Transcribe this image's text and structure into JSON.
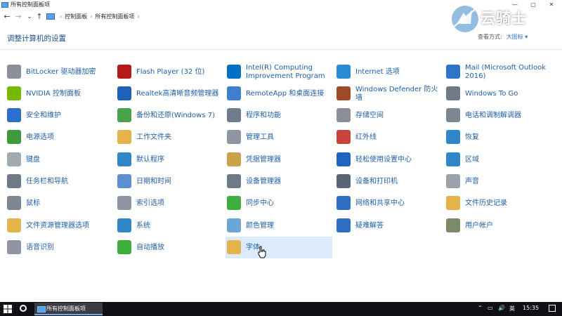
{
  "window": {
    "title": "所有控制面板项",
    "minimize": "—",
    "maximize": "▢",
    "close": "✕"
  },
  "address": {
    "back": "←",
    "forward": "→",
    "dropdown": "⌄",
    "up": "↑",
    "crumbs": [
      "控制面板",
      "所有控制面板项"
    ],
    "separator": "›"
  },
  "header": {
    "page_title": "调整计算机的设置",
    "view_by_label": "查看方式:",
    "view_by_value": "大图标 ▾"
  },
  "watermark": {
    "text": "云骑士"
  },
  "items": [
    {
      "label": "BitLocker 驱动器加密",
      "icon": "bitlocker-icon",
      "color": "#8a8f99"
    },
    {
      "label": "Flash Player (32 位)",
      "icon": "flash-icon",
      "color": "#b31b1b"
    },
    {
      "label": "Intel(R) Computing Improvement Program",
      "icon": "intel-icon",
      "color": "#0071c5"
    },
    {
      "label": "Internet 选项",
      "icon": "globe-icon",
      "color": "#2b8cd6"
    },
    {
      "label": "Mail (Microsoft Outlook 2016)",
      "icon": "mail-icon",
      "color": "#2e74c8"
    },
    {
      "label": "NVIDIA 控制面板",
      "icon": "nvidia-icon",
      "color": "#76b900"
    },
    {
      "label": "Realtek高清晰音频管理器",
      "icon": "speaker-icon",
      "color": "#1e62b8"
    },
    {
      "label": "RemoteApp 和桌面连接",
      "icon": "remoteapp-icon",
      "color": "#3e7fcf"
    },
    {
      "label": "Windows Defender 防火墙",
      "icon": "firewall-icon",
      "color": "#a04a2a"
    },
    {
      "label": "Windows To Go",
      "icon": "usb-icon",
      "color": "#6e7a88"
    },
    {
      "label": "安全和维护",
      "icon": "flag-icon",
      "color": "#2d6fd1"
    },
    {
      "label": "备份和还原(Windows 7)",
      "icon": "backup-icon",
      "color": "#4aa34a"
    },
    {
      "label": "程序和功能",
      "icon": "programs-icon",
      "color": "#6f7c8c"
    },
    {
      "label": "存储空间",
      "icon": "storage-icon",
      "color": "#8a8f99"
    },
    {
      "label": "电话和调制解调器",
      "icon": "phone-icon",
      "color": "#7d8794"
    },
    {
      "label": "电源选项",
      "icon": "power-icon",
      "color": "#3c9a3c"
    },
    {
      "label": "工作文件夹",
      "icon": "folder-icon",
      "color": "#e4b44a"
    },
    {
      "label": "管理工具",
      "icon": "admin-tools-icon",
      "color": "#8d96a2"
    },
    {
      "label": "红外线",
      "icon": "infrared-icon",
      "color": "#c8433b"
    },
    {
      "label": "恢复",
      "icon": "recovery-icon",
      "color": "#2f86c9"
    },
    {
      "label": "键盘",
      "icon": "keyboard-icon",
      "color": "#a3a9b1"
    },
    {
      "label": "默认程序",
      "icon": "default-programs-icon",
      "color": "#2f86c9"
    },
    {
      "label": "凭据管理器",
      "icon": "credential-icon",
      "color": "#c9a24a"
    },
    {
      "label": "轻松使用设置中心",
      "icon": "ease-access-icon",
      "color": "#1f64c2"
    },
    {
      "label": "区域",
      "icon": "region-icon",
      "color": "#2f86c9"
    },
    {
      "label": "任务栏和导航",
      "icon": "taskbar-icon",
      "color": "#6e7a88"
    },
    {
      "label": "日期和时间",
      "icon": "clock-icon",
      "color": "#5b8fcf"
    },
    {
      "label": "设备管理器",
      "icon": "device-manager-icon",
      "color": "#6e7a88"
    },
    {
      "label": "设备和打印机",
      "icon": "printer-icon",
      "color": "#596573"
    },
    {
      "label": "声音",
      "icon": "sound-icon",
      "color": "#9aa1aa"
    },
    {
      "label": "鼠标",
      "icon": "mouse-icon",
      "color": "#7d8794"
    },
    {
      "label": "索引选项",
      "icon": "index-icon",
      "color": "#8d96a2"
    },
    {
      "label": "同步中心",
      "icon": "sync-icon",
      "color": "#3fae3f"
    },
    {
      "label": "网络和共享中心",
      "icon": "network-icon",
      "color": "#2f6ec4"
    },
    {
      "label": "文件历史记录",
      "icon": "file-history-icon",
      "color": "#e4b44a"
    },
    {
      "label": "文件资源管理器选项",
      "icon": "explorer-options-icon",
      "color": "#e4b44a"
    },
    {
      "label": "系统",
      "icon": "system-icon",
      "color": "#2f86c9"
    },
    {
      "label": "颜色管理",
      "icon": "color-icon",
      "color": "#6aa6d8"
    },
    {
      "label": "疑难解答",
      "icon": "troubleshoot-icon",
      "color": "#2f6ec4"
    },
    {
      "label": "用户帐户",
      "icon": "users-icon",
      "color": "#7a8a6a"
    },
    {
      "label": "语音识别",
      "icon": "microphone-icon",
      "color": "#8d96a2"
    },
    {
      "label": "自动播放",
      "icon": "autoplay-icon",
      "color": "#3fae3f"
    },
    {
      "label": "字体",
      "icon": "font-icon",
      "color": "#e4b44a",
      "selected": true
    }
  ],
  "taskbar": {
    "app_label": "所有控制面板项",
    "ime": "英",
    "time": "15:35",
    "chevron": "⌃",
    "volume": "🔊",
    "network": "▭"
  },
  "colors": {
    "link": "#1f5fa6",
    "heading": "#1a4f8a",
    "selected": "#dcebfb",
    "taskbar": "#101014"
  }
}
